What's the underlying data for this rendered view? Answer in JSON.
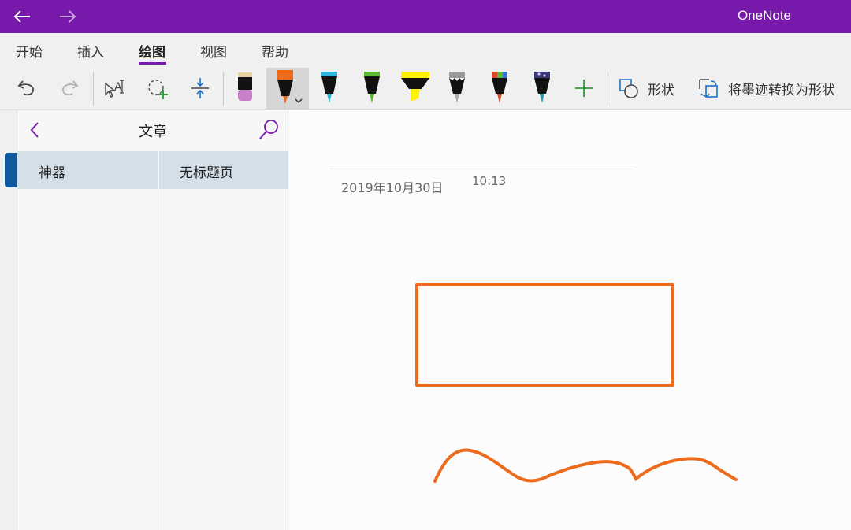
{
  "app": {
    "title": "OneNote"
  },
  "ribbon": {
    "tabs": [
      "开始",
      "插入",
      "绘图",
      "视图",
      "帮助"
    ],
    "active_tab": "绘图",
    "shapes_label": "形状",
    "ink_to_shape_label": "将墨迹转换为形状"
  },
  "pens": [
    {
      "name": "eraser",
      "color": "#c97fc9"
    },
    {
      "name": "pen-orange",
      "color": "#ec6b1c",
      "selected": true
    },
    {
      "name": "pen-cyan",
      "color": "#2fb6dd"
    },
    {
      "name": "pen-green",
      "color": "#5db92f"
    },
    {
      "name": "highlighter-yellow",
      "color": "#fff200"
    },
    {
      "name": "pen-gray-glitter",
      "color": "#9a9a9a"
    },
    {
      "name": "pen-multicolor",
      "color": "#d64a2a"
    },
    {
      "name": "pen-galaxy",
      "color": "#2c9cae"
    }
  ],
  "accent_color": "#7719aa",
  "ink_color": "#ec6b1c",
  "navigation": {
    "header_title": "文章",
    "sections": [
      "神器"
    ],
    "pages": [
      "无标题页"
    ]
  },
  "page": {
    "date": "2019年10月30日",
    "time": "10:13"
  }
}
